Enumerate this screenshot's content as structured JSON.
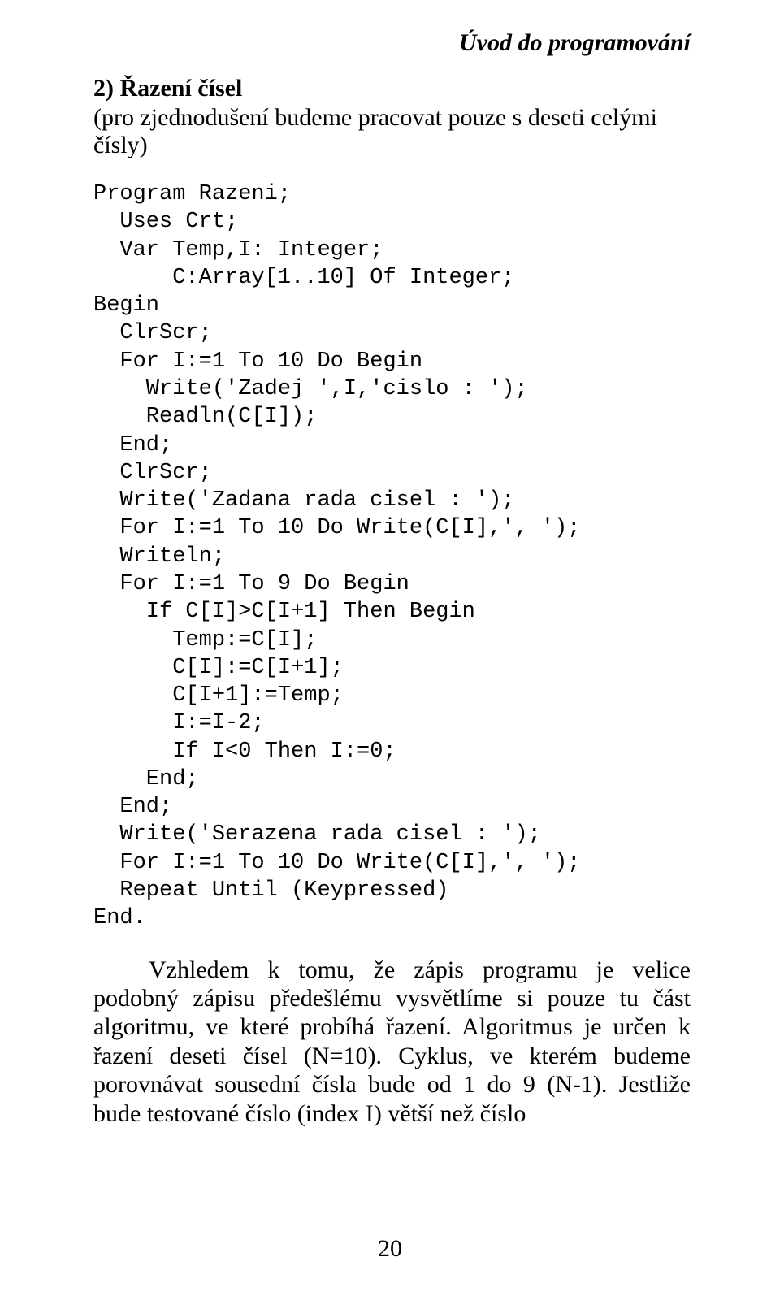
{
  "header": "Úvod do programování",
  "section": {
    "title": "2) Řazení čísel",
    "subtitle": "(pro zjednodušení budeme pracovat pouze s deseti celými čísly)"
  },
  "code": "Program Razeni;\n  Uses Crt;\n  Var Temp,I: Integer;\n      C:Array[1..10] Of Integer;\nBegin\n  ClrScr;\n  For I:=1 To 10 Do Begin\n    Write('Zadej ',I,'cislo : ');\n    Readln(C[I]);\n  End;\n  ClrScr;\n  Write('Zadana rada cisel : ');\n  For I:=1 To 10 Do Write(C[I],', ');\n  Writeln;\n  For I:=1 To 9 Do Begin\n    If C[I]>C[I+1] Then Begin\n      Temp:=C[I];\n      C[I]:=C[I+1];\n      C[I+1]:=Temp;\n      I:=I-2;\n      If I<0 Then I:=0;\n    End;\n  End;\n  Write('Serazena rada cisel : ');\n  For I:=1 To 10 Do Write(C[I],', ');\n  Repeat Until (Keypressed)\nEnd.",
  "paragraph": "Vzhledem k tomu, že zápis programu je velice podobný zápisu předešlému vysvětlíme si pouze tu část algoritmu, ve které probíhá řazení. Algoritmus je určen k řazení deseti čísel (N=10). Cyklus, ve kterém budeme porovnávat sousední čísla bude od 1 do 9 (N-1). Jestliže bude testované číslo (index I) větší než číslo",
  "pageNumber": "20"
}
